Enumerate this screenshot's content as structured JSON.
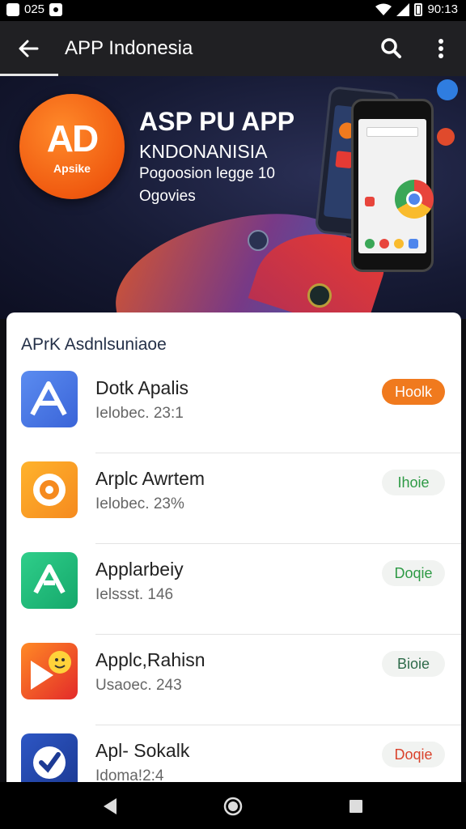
{
  "status_bar": {
    "left_text": "025",
    "time": "90:13"
  },
  "app_bar": {
    "title": "APP Indonesia"
  },
  "banner": {
    "logo_mark": "AD",
    "logo_sub": "Apsike",
    "title": "ASP PU APP",
    "subtitle": "KNDONANISIA",
    "line1": "Pogoosion legge 10",
    "line2": "Ogovies"
  },
  "list": {
    "title": "APrK Asdnlsuniaoe",
    "items": [
      {
        "name": "Dotk Apalis",
        "meta": "Ielobec. 23:1",
        "button": "Hoolk",
        "accent": "#f07a1e"
      },
      {
        "name": "Arplc Awrtem",
        "meta": "Ielobec. 23%",
        "button": "Ihoie",
        "accent": "#2e9a45"
      },
      {
        "name": "Applarbeiy",
        "meta": "Ielssst. 146",
        "button": "Doqie",
        "accent": "#2e9a45"
      },
      {
        "name": "Applc,Rahisn",
        "meta": "Usaoec. 243",
        "button": "Bioie",
        "accent": "#2e9a45"
      },
      {
        "name": "Apl- Sokalk",
        "meta": "Idoma!2:4",
        "button": "Doqie",
        "accent": "#d9432c"
      }
    ]
  },
  "colors": {
    "app_bar": "#202023",
    "accent_orange": "#f07a1e",
    "accent_green": "#2e9a45"
  }
}
